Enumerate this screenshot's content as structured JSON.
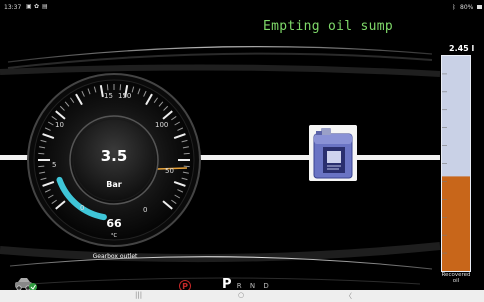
{
  "status_bar": {
    "time": "13:37",
    "battery": "80%",
    "left_icons": [
      "image-icon",
      "settings-icon",
      "calendar-icon"
    ],
    "right_icons": [
      "bluetooth-icon",
      "battery-icon"
    ]
  },
  "app": {
    "title": "Empting oil sump",
    "gauge": {
      "scale_labels": [
        "0",
        "5",
        "10",
        "15",
        "150",
        "100",
        "50",
        "0"
      ],
      "pressure_value": "3.5",
      "pressure_unit": "Bar",
      "temperature_value": "66",
      "temperature_unit": "°C",
      "caption": "Gearbox outlet",
      "pressure_level_fraction": 0.23
    },
    "cylinder": {
      "value": "2.45 l",
      "label": "Recovered oil",
      "fill_fraction": 0.44,
      "oil_color": "#c8661a",
      "empty_color": "#c9d1e6"
    },
    "gear_selector": {
      "gears": [
        "P",
        "R",
        "N",
        "D"
      ],
      "selected": "P"
    },
    "parking_brake_symbol": "P",
    "car_icon": "car-service-icon"
  },
  "nav_bar": {
    "buttons": [
      "recents-icon",
      "home-icon",
      "back-icon"
    ],
    "glyphs": [
      "|||",
      "○",
      "〈"
    ]
  },
  "colors": {
    "title_green": "#7fd96a",
    "gauge_cyan": "#3fc6d8",
    "gauge_orange": "#e8a33a",
    "park_red": "#c62828"
  }
}
